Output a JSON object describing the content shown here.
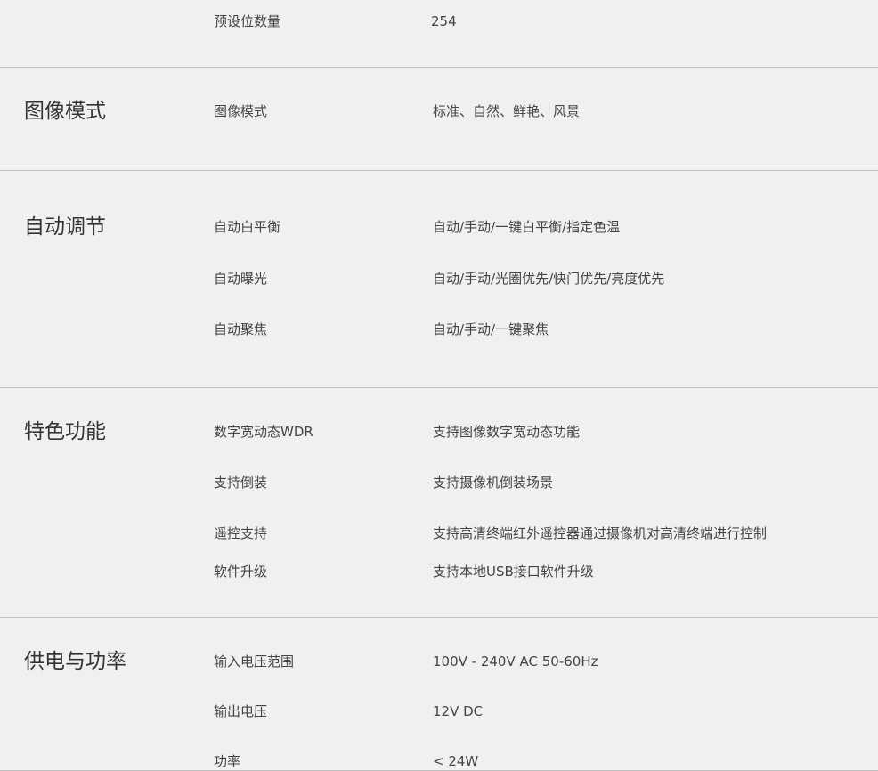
{
  "sections": [
    {
      "title": "",
      "rows": [
        {
          "label": "预设位数量",
          "value": "254"
        }
      ]
    },
    {
      "title": "图像模式",
      "rows": [
        {
          "label": "图像模式",
          "value": "标准、自然、鲜艳、风景"
        }
      ]
    },
    {
      "title": "自动调节",
      "rows": [
        {
          "label": "自动白平衡",
          "value": "自动/手动/一键白平衡/指定色温"
        },
        {
          "label": "自动曝光",
          "value": "自动/手动/光圈优先/快门优先/亮度优先"
        },
        {
          "label": "自动聚焦",
          "value": "自动/手动/一键聚焦"
        }
      ]
    },
    {
      "title": "特色功能",
      "rows": [
        {
          "label": "数字宽动态WDR",
          "value": "支持图像数字宽动态功能"
        },
        {
          "label": "支持倒装",
          "value": "支持摄像机倒装场景"
        },
        {
          "label": "遥控支持",
          "value": "支持高清终端红外遥控器通过摄像机对高清终端进行控制"
        },
        {
          "label": "软件升级",
          "value": "支持本地USB接口软件升级"
        }
      ]
    },
    {
      "title": "供电与功率",
      "rows": [
        {
          "label": "输入电压范围",
          "value": "100V - 240V AC 50-60Hz"
        },
        {
          "label": "输出电压",
          "value": "12V DC"
        },
        {
          "label": "功率",
          "value": "< 24W"
        }
      ]
    }
  ]
}
